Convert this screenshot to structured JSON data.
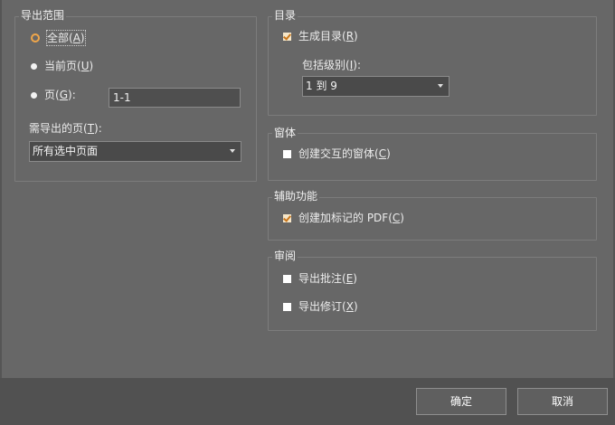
{
  "export_range": {
    "title": "导出范围",
    "all": {
      "label": "全部",
      "key": "A",
      "checked": true
    },
    "current_page": {
      "label": "当前页",
      "key": "U",
      "checked": false
    },
    "pages": {
      "label": "页",
      "key": "G",
      "suffix": ":",
      "checked": false,
      "value": "1-1"
    },
    "pages_to_export": {
      "label": "需导出的页",
      "key": "T",
      "suffix": ":",
      "selected": "所有选中页面"
    }
  },
  "toc": {
    "title": "目录",
    "generate": {
      "label": "生成目录",
      "key": "R",
      "checked": true
    },
    "levels": {
      "label": "包括级别",
      "key": "I",
      "suffix": ":",
      "selected": "1 到 9"
    }
  },
  "forms": {
    "title": "窗体",
    "create_interactive": {
      "label": "创建交互的窗体",
      "key": "C",
      "checked": false
    }
  },
  "accessibility": {
    "title": "辅助功能",
    "tagged_pdf": {
      "label": "创建加标记的 PDF",
      "key": "C",
      "checked": true
    }
  },
  "review": {
    "title": "审阅",
    "export_comments": {
      "label": "导出批注",
      "key": "E",
      "checked": false
    },
    "export_revisions": {
      "label": "导出修订",
      "key": "X",
      "checked": false
    }
  },
  "buttons": {
    "ok": "确定",
    "cancel": "取消"
  },
  "colors": {
    "background": "#676767",
    "footer": "#515151",
    "accent": "#f0a64a"
  }
}
